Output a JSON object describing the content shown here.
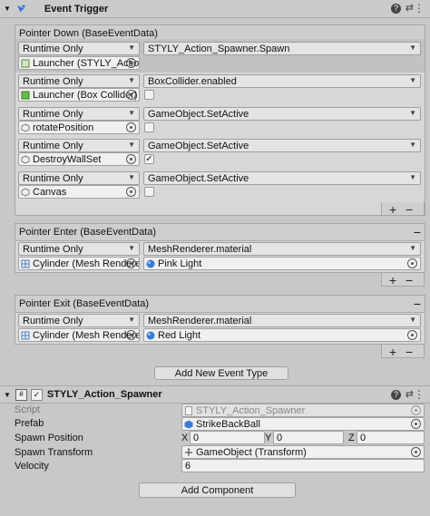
{
  "event_trigger": {
    "title": "Event Trigger",
    "pointer_down": {
      "header": "Pointer Down (BaseEventData)",
      "entries": [
        {
          "runtime": "Runtime Only",
          "function": "STYLY_Action_Spawner.Spawn",
          "object": "Launcher (STYLY_Action_"
        },
        {
          "runtime": "Runtime Only",
          "function": "BoxCollider.enabled",
          "object": "Launcher (Box Collider)",
          "check": ""
        },
        {
          "runtime": "Runtime Only",
          "function": "GameObject.SetActive",
          "object": "rotatePosition",
          "check": ""
        },
        {
          "runtime": "Runtime Only",
          "function": "GameObject.SetActive",
          "object": "DestroyWallSet",
          "check": "✓"
        },
        {
          "runtime": "Runtime Only",
          "function": "GameObject.SetActive",
          "object": "Canvas",
          "check": ""
        }
      ]
    },
    "pointer_enter": {
      "header": "Pointer Enter (BaseEventData)",
      "runtime": "Runtime Only",
      "function": "MeshRenderer.material",
      "object": "Cylinder (Mesh Renderer)",
      "argument": "Pink Light"
    },
    "pointer_exit": {
      "header": "Pointer Exit (BaseEventData)",
      "runtime": "Runtime Only",
      "function": "MeshRenderer.material",
      "object": "Cylinder (Mesh Renderer)",
      "argument": "Red Light"
    },
    "plus": "+",
    "minus": "−",
    "add_event_label": "Add New Event Type"
  },
  "spawner": {
    "title": "STYLY_Action_Spawner",
    "enabled_check": "✓",
    "script_label": "Script",
    "script_value": "STYLY_Action_Spawner",
    "prefab_label": "Prefab",
    "prefab_value": "StrikeBackBall",
    "spawn_position_label": "Spawn Position",
    "x_label": "X",
    "x_value": "0",
    "y_label": "Y",
    "y_value": "0",
    "z_label": "Z",
    "z_value": "0",
    "spawn_transform_label": "Spawn Transform",
    "spawn_transform_value": "GameObject (Transform)",
    "velocity_label": "Velocity",
    "velocity_value": "6"
  },
  "add_component_label": "Add Component",
  "header_icons": [
    "help-icon",
    "preset-icon",
    "more-icon"
  ]
}
